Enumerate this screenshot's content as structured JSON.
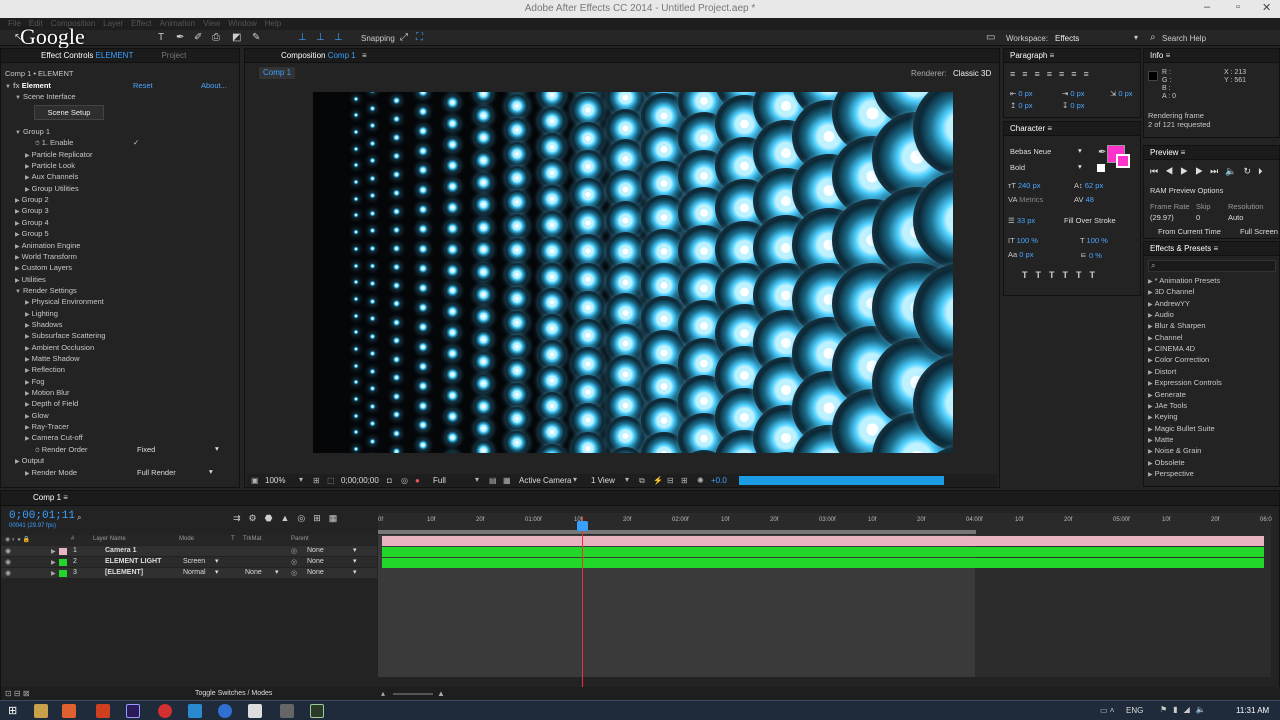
{
  "app": {
    "title": "Adobe After Effects CC 2014 - Untitled Project.aep *",
    "watermark": "Google"
  },
  "menus": [
    "File",
    "Edit",
    "Composition",
    "Layer",
    "Effect",
    "Animation",
    "View",
    "Window",
    "Help"
  ],
  "toolbar": {
    "snapping": "Snapping",
    "workspace_label": "Workspace:",
    "workspace_value": "Effects",
    "search_help": "Search Help"
  },
  "effect_controls": {
    "tab": "Effect Controls",
    "tab_layer": "ELEMENT",
    "tab2": "Project",
    "header": "Comp 1 • ELEMENT",
    "effect_name": "Element",
    "reset": "Reset",
    "about": "About...",
    "scene_interface": "Scene Interface",
    "scene_setup": "Scene Setup",
    "items": [
      {
        "label": "Group 1",
        "indent": 1,
        "open": true
      },
      {
        "label": "1. Enable",
        "indent": 3,
        "check": true
      },
      {
        "label": "Particle Replicator",
        "indent": 2
      },
      {
        "label": "Particle Look",
        "indent": 2
      },
      {
        "label": "Aux Channels",
        "indent": 2
      },
      {
        "label": "Group Utilities",
        "indent": 2
      },
      {
        "label": "Group 2",
        "indent": 1
      },
      {
        "label": "Group 3",
        "indent": 1
      },
      {
        "label": "Group 4",
        "indent": 1
      },
      {
        "label": "Group 5",
        "indent": 1
      },
      {
        "label": "Animation Engine",
        "indent": 1
      },
      {
        "label": "World Transform",
        "indent": 1
      },
      {
        "label": "Custom Layers",
        "indent": 1
      },
      {
        "label": "Utilities",
        "indent": 1
      },
      {
        "label": "Render Settings",
        "indent": 1,
        "open": true
      },
      {
        "label": "Physical Environment",
        "indent": 2
      },
      {
        "label": "Lighting",
        "indent": 2
      },
      {
        "label": "Shadows",
        "indent": 2
      },
      {
        "label": "Subsurface Scattering",
        "indent": 2
      },
      {
        "label": "Ambient Occlusion",
        "indent": 2
      },
      {
        "label": "Matte Shadow",
        "indent": 2
      },
      {
        "label": "Reflection",
        "indent": 2
      },
      {
        "label": "Fog",
        "indent": 2
      },
      {
        "label": "Motion Blur",
        "indent": 2
      },
      {
        "label": "Depth of Field",
        "indent": 2
      },
      {
        "label": "Glow",
        "indent": 2
      },
      {
        "label": "Ray-Tracer",
        "indent": 2
      },
      {
        "label": "Camera Cut-off",
        "indent": 2
      },
      {
        "label": "Render Order",
        "indent": 3,
        "value": "Fixed"
      },
      {
        "label": "Output",
        "indent": 1
      },
      {
        "label": "Render Mode",
        "indent": 2,
        "value": "Full Render"
      }
    ]
  },
  "composition": {
    "tab": "Composition",
    "tab_comp": "Comp 1",
    "subtab": "Comp 1",
    "renderer_label": "Renderer:",
    "renderer_value": "Classic 3D",
    "zoom": "100%",
    "timecode": "0;00;00;00",
    "quality": "Full",
    "camera": "Active Camera",
    "view": "1 View",
    "exposure": "+0.0"
  },
  "paragraph": {
    "tab": "Paragraph",
    "v1": "0 px",
    "v2": "0 px",
    "v3": "0 px",
    "v4": "0 px",
    "v5": "0 px"
  },
  "info": {
    "tab": "Info",
    "r": "R :",
    "g": "G :",
    "b": "B :",
    "a": "A : 0",
    "x": "X : 213",
    "y": "Y : 561",
    "status1": "Rendering frame",
    "status2": "2 of 121 requested"
  },
  "character": {
    "tab": "Character",
    "font": "Bebas Neue",
    "style": "Bold",
    "size": "240 px",
    "leading": "62 px",
    "kerning": "Metrics",
    "tracking": "48",
    "stroke_width": "33 px",
    "stroke_type": "Fill Over Stroke",
    "vscale": "100 %",
    "hscale": "100 %",
    "baseline": "0 px",
    "tsume": "0 %"
  },
  "preview": {
    "tab": "Preview",
    "ram_options": "RAM Preview Options",
    "frame_rate_label": "Frame Rate",
    "skip_label": "Skip",
    "resolution_label": "Resolution",
    "frame_rate": "(29.97)",
    "skip": "0",
    "resolution": "Auto",
    "from_current": "From Current Time",
    "full_screen": "Full Screen"
  },
  "effects_presets": {
    "tab": "Effects & Presets",
    "search_placeholder": "",
    "items": [
      "* Animation Presets",
      "3D Channel",
      "AndrewYY",
      "Audio",
      "Blur & Sharpen",
      "Channel",
      "CINEMA 4D",
      "Color Correction",
      "Distort",
      "Expression Controls",
      "Generate",
      "JAe Tools",
      "Keying",
      "Magic Bullet Suite",
      "Matte",
      "Noise & Grain",
      "Obsolete",
      "Perspective"
    ]
  },
  "timeline": {
    "tab": "Comp 1",
    "timecode": "0;00;01;11",
    "fps": "00041 (29.97 fps)",
    "col_layer": "Layer Name",
    "col_mode": "Mode",
    "col_t": "T",
    "col_trkmat": "TrkMat",
    "col_parent": "Parent",
    "ruler": [
      "0f",
      "10f",
      "20f",
      "01:00f",
      "10f",
      "20f",
      "02:00f",
      "10f",
      "20f",
      "03:00f",
      "10f",
      "20f",
      "04:00f",
      "10f",
      "20f",
      "05:00f",
      "10f",
      "20f",
      "06:0"
    ],
    "layers": [
      {
        "num": "1",
        "name": "Camera 1",
        "mode": "",
        "trkmat": "",
        "parent": "None",
        "color": "#e8b4c0"
      },
      {
        "num": "2",
        "name": "ELEMENT LIGHT",
        "mode": "Screen",
        "trkmat": "",
        "parent": "None",
        "color": "#23d62a"
      },
      {
        "num": "3",
        "name": "[ELEMENT]",
        "mode": "Normal",
        "trkmat": "None",
        "parent": "None",
        "color": "#23d62a"
      }
    ],
    "toggle": "Toggle Switches / Modes"
  },
  "taskbar": {
    "time": "11:31 AM",
    "lang": "ENG"
  }
}
